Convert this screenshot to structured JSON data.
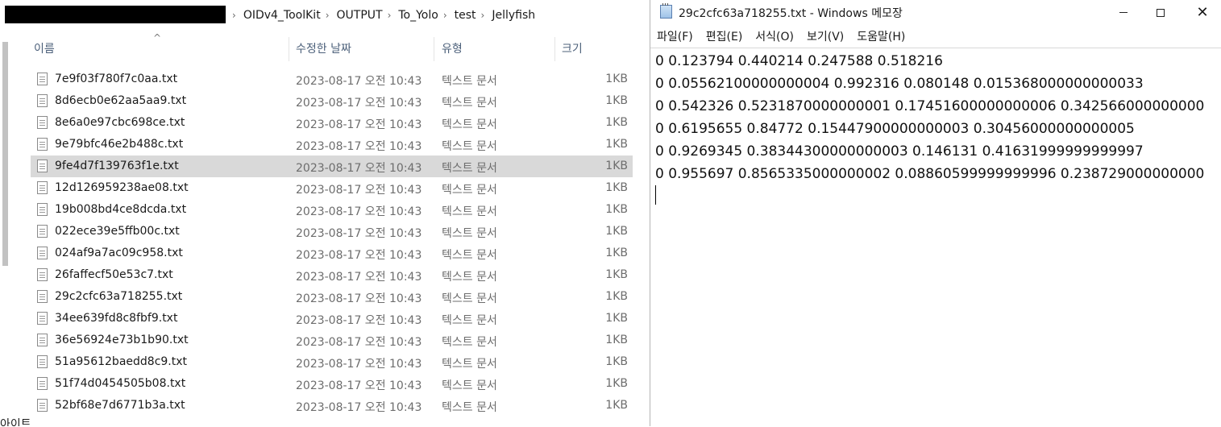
{
  "explorer": {
    "breadcrumbs": [
      "OIDv4_ToolKit",
      "OUTPUT",
      "To_Yolo",
      "test",
      "Jellyfish"
    ],
    "columns": {
      "name": "이름",
      "modified": "수정한 날짜",
      "type": "유형",
      "size": "크기"
    },
    "files": [
      {
        "name": "7e9f03f780f7c0aa.txt",
        "modified": "2023-08-17 오전 10:43",
        "type": "텍스트 문서",
        "size": "1KB"
      },
      {
        "name": "8d6ecb0e62aa5aa9.txt",
        "modified": "2023-08-17 오전 10:43",
        "type": "텍스트 문서",
        "size": "1KB"
      },
      {
        "name": "8e6a0e97cbc698ce.txt",
        "modified": "2023-08-17 오전 10:43",
        "type": "텍스트 문서",
        "size": "1KB"
      },
      {
        "name": "9e79bfc46e2b488c.txt",
        "modified": "2023-08-17 오전 10:43",
        "type": "텍스트 문서",
        "size": "1KB"
      },
      {
        "name": "9fe4d7f139763f1e.txt",
        "modified": "2023-08-17 오전 10:43",
        "type": "텍스트 문서",
        "size": "1KB",
        "selected": true
      },
      {
        "name": "12d126959238ae08.txt",
        "modified": "2023-08-17 오전 10:43",
        "type": "텍스트 문서",
        "size": "1KB"
      },
      {
        "name": "19b008bd4ce8dcda.txt",
        "modified": "2023-08-17 오전 10:43",
        "type": "텍스트 문서",
        "size": "1KB"
      },
      {
        "name": "022ece39e5ffb00c.txt",
        "modified": "2023-08-17 오전 10:43",
        "type": "텍스트 문서",
        "size": "1KB"
      },
      {
        "name": "024af9a7ac09c958.txt",
        "modified": "2023-08-17 오전 10:43",
        "type": "텍스트 문서",
        "size": "1KB"
      },
      {
        "name": "26faffecf50e53c7.txt",
        "modified": "2023-08-17 오전 10:43",
        "type": "텍스트 문서",
        "size": "1KB"
      },
      {
        "name": "29c2cfc63a718255.txt",
        "modified": "2023-08-17 오전 10:43",
        "type": "텍스트 문서",
        "size": "1KB"
      },
      {
        "name": "34ee639fd8c8fbf9.txt",
        "modified": "2023-08-17 오전 10:43",
        "type": "텍스트 문서",
        "size": "1KB"
      },
      {
        "name": "36e56924e73b1b90.txt",
        "modified": "2023-08-17 오전 10:43",
        "type": "텍스트 문서",
        "size": "1KB"
      },
      {
        "name": "51a95612baedd8c9.txt",
        "modified": "2023-08-17 오전 10:43",
        "type": "텍스트 문서",
        "size": "1KB"
      },
      {
        "name": "51f74d0454505b08.txt",
        "modified": "2023-08-17 오전 10:43",
        "type": "텍스트 문서",
        "size": "1KB"
      },
      {
        "name": "52bf68e7d6771b3a.txt",
        "modified": "2023-08-17 오전 10:43",
        "type": "텍스트 문서",
        "size": "1KB"
      }
    ],
    "bottom_fragment": "아이트"
  },
  "notepad": {
    "title": "29c2cfc63a718255.txt - Windows 메모장",
    "menu": [
      "파일(F)",
      "편집(E)",
      "서식(O)",
      "보기(V)",
      "도움말(H)"
    ],
    "lines": [
      "0 0.123794 0.440214 0.247588 0.518216",
      "0 0.05562100000000004 0.992316 0.080148 0.015368000000000033",
      "0 0.542326 0.5231870000000001 0.17451600000000006 0.342566000000000",
      "0 0.6195655 0.84772 0.15447900000000003 0.30456000000000005",
      "0 0.9269345 0.38344300000000003 0.146131 0.41631999999999997",
      "0 0.955697 0.8565335000000002 0.08860599999999996 0.238729000000000"
    ]
  },
  "icons": {
    "file": "text-file-icon",
    "notepad": "notepad-app-icon",
    "sort": "sort-ascending-icon"
  }
}
